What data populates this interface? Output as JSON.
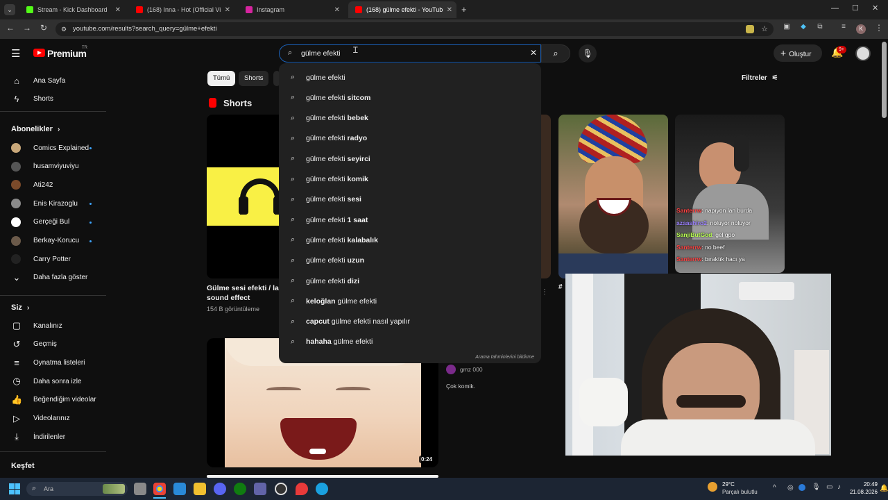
{
  "tabs": [
    {
      "title": "Stream - Kick Dashboard",
      "color": "#53fc18"
    },
    {
      "title": "(168) Inna - Hot (Official Vi",
      "color": "#ff0000"
    },
    {
      "title": "Instagram",
      "color": "#d6249f"
    },
    {
      "title": "(168) gülme efekti - YouTub",
      "color": "#ff0000"
    }
  ],
  "url": "youtube.com/results?search_query=gülme+efekti",
  "logo": {
    "text": "Premium",
    "region": "TR"
  },
  "search": {
    "value": "gülme efekti",
    "placeholder": ""
  },
  "create_label": "Oluştur",
  "notif_badge": "9+",
  "sidebar": {
    "main": [
      {
        "label": "Ana Sayfa",
        "icon": "home-icon"
      },
      {
        "label": "Shorts",
        "icon": "shorts-icon"
      }
    ],
    "subs_header": "Abonelikler",
    "subs": [
      {
        "label": "Comics Explained",
        "dot": true,
        "color": "#c9a87a"
      },
      {
        "label": "husamviyuviyu",
        "dot": false,
        "color": "#555"
      },
      {
        "label": "Ati242",
        "dot": false,
        "color": "#7a4a2a"
      },
      {
        "label": "Enis Kirazoglu",
        "dot": true,
        "color": "#8a8a8a"
      },
      {
        "label": "Gerçeği Bul",
        "dot": true,
        "color": "#ffffff"
      },
      {
        "label": "Berkay-Korucu",
        "dot": true,
        "color": "#6b5a4a"
      },
      {
        "label": "Carry Potter",
        "dot": false,
        "color": "#222"
      },
      {
        "label": "Daha fazla göster",
        "dot": false,
        "color": ""
      }
    ],
    "you_header": "Siz",
    "you": [
      {
        "label": "Kanalınız",
        "icon": "channel-icon"
      },
      {
        "label": "Geçmiş",
        "icon": "history-icon"
      },
      {
        "label": "Oynatma listeleri",
        "icon": "playlists-icon"
      },
      {
        "label": "Daha sonra izle",
        "icon": "clock-icon"
      },
      {
        "label": "Beğendiğim videolar",
        "icon": "like-icon"
      },
      {
        "label": "Videolarınız",
        "icon": "video-icon"
      },
      {
        "label": "İndirilenler",
        "icon": "download-icon"
      }
    ],
    "explore_header": "Keşfet"
  },
  "chips": [
    "Tümü",
    "Shorts"
  ],
  "filters_label": "Filtreler",
  "shorts_header": "Shorts",
  "short1": {
    "title_line1": "Gülme sesi efekti / lau",
    "title_line2": "sound effect",
    "views": "154 B görüntüleme"
  },
  "short3_prefix": "#",
  "short4": {
    "chat": [
      {
        "user": "Santerrw",
        "msg": ": napıyon lan burda"
      },
      {
        "user": "azaashiro2",
        "msg": ": noluyor noluyor"
      },
      {
        "user": "SanjiButGod",
        "msg": ": gel gpo"
      },
      {
        "user": "Santerrw",
        "msg": ": no beef"
      },
      {
        "user": "Santerrw",
        "msg": ": bıraktık hacı ya"
      }
    ]
  },
  "video_duration": "0:24",
  "comment": {
    "user": "gmz 000",
    "text": "Çok komik."
  },
  "suggestions": [
    {
      "plain": "gülme efekti",
      "bold": ""
    },
    {
      "plain": "gülme efekti",
      "bold": " sitcom"
    },
    {
      "plain": "gülme efekti",
      "bold": " bebek"
    },
    {
      "plain": "gülme efekti",
      "bold": " radyo"
    },
    {
      "plain": "gülme efekti",
      "bold": " seyirci"
    },
    {
      "plain": "gülme efekti",
      "bold": " komik"
    },
    {
      "plain": "gülme efekti",
      "bold": " sesi"
    },
    {
      "plain": "gülme efekti",
      "bold": " 1 saat"
    },
    {
      "plain": "gülme efekti",
      "bold": " kalabalık"
    },
    {
      "plain": "gülme efekti",
      "bold": " uzun"
    },
    {
      "plain": "gülme efekti",
      "bold": " dizi"
    },
    {
      "pre": "keloğlan",
      "plain": " gülme efekti",
      "bold": ""
    },
    {
      "pre": "capcut",
      "plain": " gülme efekti nasıl yapılır",
      "bold": ""
    },
    {
      "pre": "hahaha",
      "plain": " gülme efekti",
      "bold": ""
    }
  ],
  "report_predictions": "Arama tahminlerini bildirme",
  "taskbar": {
    "search": "Ara",
    "weather_temp": "29°C",
    "weather_desc": "Parçalı bulutlu",
    "time": "20:49",
    "date": "21.08.2026"
  }
}
